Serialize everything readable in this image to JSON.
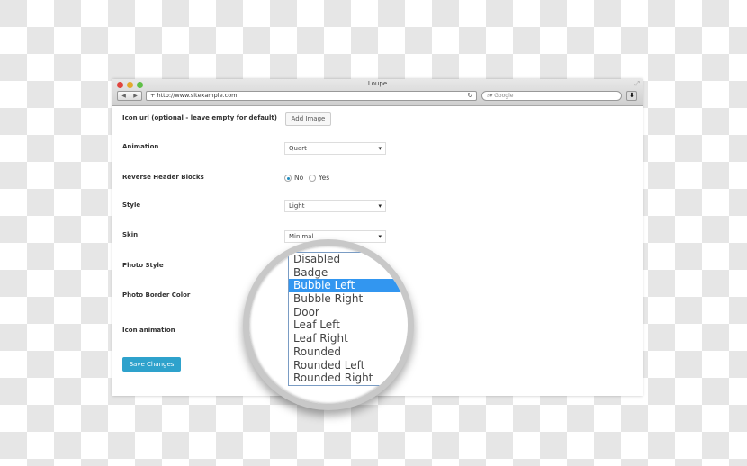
{
  "window": {
    "title": "Loupe",
    "url": "http://www.sitexample.com",
    "search_placeholder": "Google"
  },
  "form": {
    "icon_url_label": "Icon url (optional - leave empty for default)",
    "add_image_label": "Add Image",
    "animation_label": "Animation",
    "animation_value": "Quart",
    "reverse_label": "Reverse Header Blocks",
    "reverse_no": "No",
    "reverse_yes": "Yes",
    "reverse_selected": "No",
    "style_label": "Style",
    "style_value": "Light",
    "skin_label": "Skin",
    "skin_value": "Minimal",
    "photo_style_label": "Photo Style",
    "photo_border_label": "Photo Border Color",
    "icon_animation_label": "Icon animation",
    "save_label": "Save Changes"
  },
  "dropdown": {
    "selected": "Bubble Left",
    "options": [
      "Disabled",
      "Badge",
      "Bubble Left",
      "Bubble Right",
      "Door",
      "Leaf Left",
      "Leaf Right",
      "Rounded",
      "Rounded Left",
      "Rounded Right"
    ]
  },
  "colors": {
    "accent": "#2ea2cc",
    "highlight": "#3296f0"
  }
}
